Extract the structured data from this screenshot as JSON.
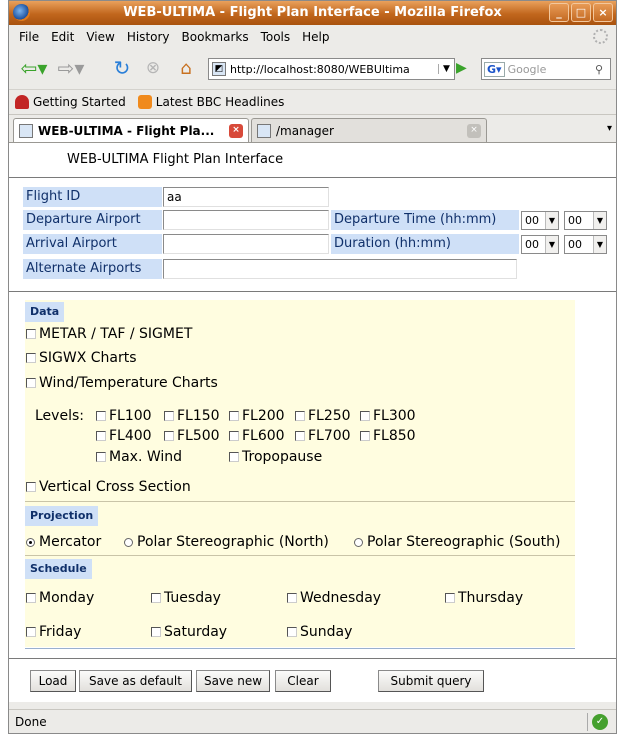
{
  "window": {
    "title": "WEB-ULTIMA - Flight Plan Interface - Mozilla Firefox"
  },
  "menu": [
    {
      "label": "File"
    },
    {
      "label": "Edit"
    },
    {
      "label": "View"
    },
    {
      "label": "History"
    },
    {
      "label": "Bookmarks"
    },
    {
      "label": "Tools"
    },
    {
      "label": "Help"
    }
  ],
  "nav": {
    "url": "http://localhost:8080/WEBUltima",
    "search_placeholder": "Google"
  },
  "bookmarks": [
    {
      "label": "Getting Started"
    },
    {
      "label": "Latest BBC Headlines"
    }
  ],
  "tabs": [
    {
      "label": "WEB-ULTIMA - Flight Pla..."
    },
    {
      "label": "/manager"
    }
  ],
  "page": {
    "title": "WEB-ULTIMA Flight Plan Interface",
    "fields": {
      "flight_id_label": "Flight ID",
      "flight_id_value": "aa",
      "departure_airport_label": "Departure Airport",
      "arrival_airport_label": "Arrival Airport",
      "alternate_airports_label": "Alternate Airports",
      "departure_time_label": "Departure Time (hh:mm)",
      "duration_label": "Duration (hh:mm)",
      "dep_hh": "00",
      "dep_mm": "00",
      "dur_hh": "00",
      "dur_mm": "00"
    },
    "data_section": {
      "label": "Data",
      "metar": "METAR / TAF / SIGMET",
      "sigwx": "SIGWX Charts",
      "wind": "Wind/Temperature Charts",
      "levels_label": "Levels:",
      "levels": [
        "FL100",
        "FL150",
        "FL200",
        "FL250",
        "FL300",
        "FL400",
        "FL500",
        "FL600",
        "FL700",
        "FL850"
      ],
      "max_wind": "Max. Wind",
      "tropopause": "Tropopause",
      "vertical": "Vertical Cross Section"
    },
    "projection_section": {
      "label": "Projection",
      "options": [
        "Mercator",
        "Polar Stereographic (North)",
        "Polar Stereographic (South)"
      ],
      "selected": "Mercator"
    },
    "schedule_section": {
      "label": "Schedule",
      "days": [
        "Monday",
        "Tuesday",
        "Wednesday",
        "Thursday",
        "Friday",
        "Saturday",
        "Sunday"
      ]
    },
    "buttons": {
      "load": "Load",
      "save_default": "Save as default",
      "save_new": "Save new",
      "clear": "Clear",
      "submit": "Submit query"
    }
  },
  "status": {
    "text": "Done"
  }
}
